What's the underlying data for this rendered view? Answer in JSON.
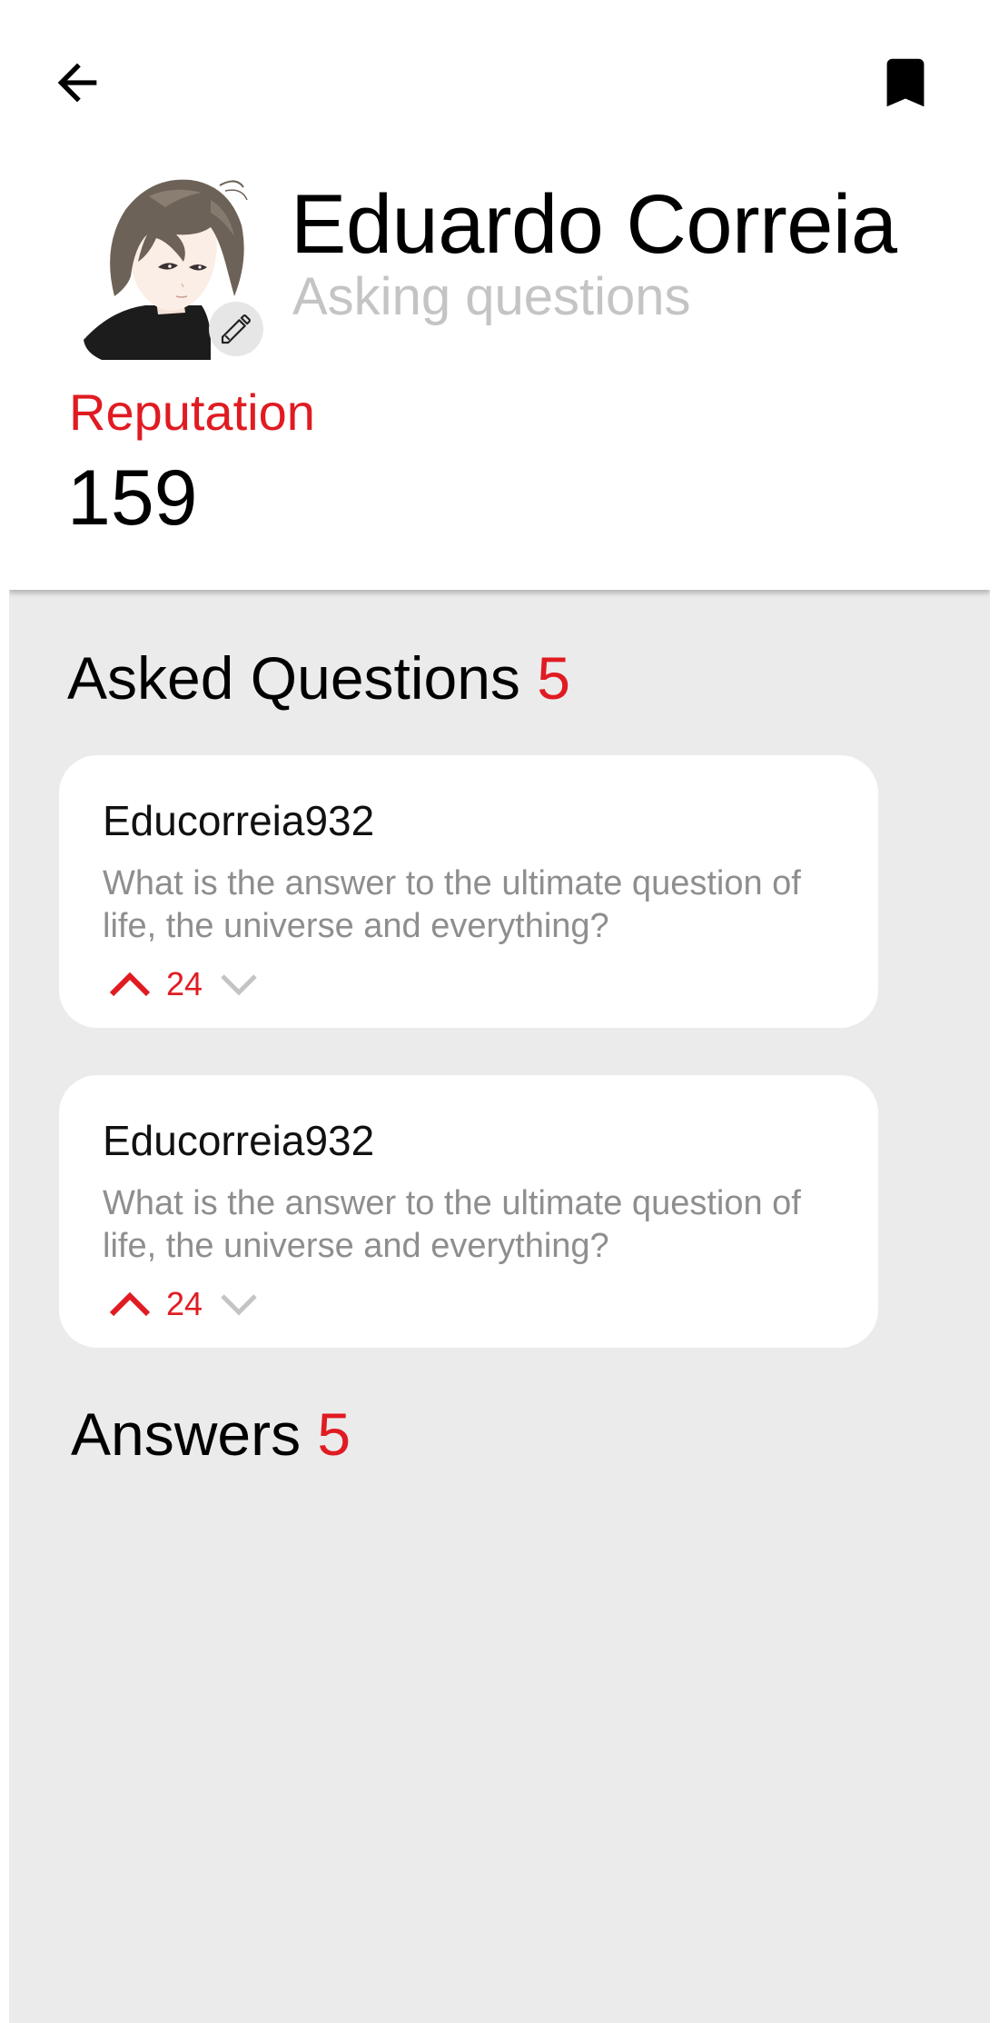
{
  "header": {
    "user_name": "Eduardo Correia",
    "user_status": "Asking questions",
    "reputation_label": "Reputation",
    "reputation_value": "159"
  },
  "icons": {
    "back": "arrow-left-icon",
    "bookmark": "bookmark-icon",
    "edit": "pencil-icon",
    "upvote": "chevron-up-icon",
    "downvote": "chevron-down-icon"
  },
  "colors": {
    "accent": "#e01b22",
    "background": "#ebebeb",
    "card": "#ffffff",
    "muted_text": "#8e8e8e",
    "status_text": "#c4c4c4"
  },
  "asked_questions": {
    "title": "Asked Questions",
    "count": "5",
    "items": [
      {
        "user": "Educorreia932",
        "text": "What is the answer to the ultimate question of life, the universe and everything?",
        "votes": "24"
      },
      {
        "user": "Educorreia932",
        "text": "What is the answer to the ultimate question of life, the universe and everything?",
        "votes": "24"
      }
    ]
  },
  "answers": {
    "title": "Answers",
    "count": "5"
  }
}
